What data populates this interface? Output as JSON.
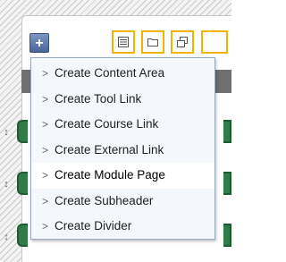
{
  "toolbar": {
    "add_glyph": "+",
    "icons": [
      "list-icon",
      "folder-icon",
      "windows-icon"
    ]
  },
  "menu": {
    "chevron": ">",
    "items": [
      {
        "label": "Create Content Area",
        "active": false
      },
      {
        "label": "Create Tool Link",
        "active": false
      },
      {
        "label": "Create Course Link",
        "active": false
      },
      {
        "label": "Create External Link",
        "active": false
      },
      {
        "label": "Create Module Page",
        "active": true
      },
      {
        "label": "Create Subheader",
        "active": false
      },
      {
        "label": "Create Divider",
        "active": false
      }
    ]
  },
  "colors": {
    "toolbar_icon_border": "#f0b400",
    "menu_background": "#f4f7fb",
    "item_green": "#2f7c49"
  }
}
